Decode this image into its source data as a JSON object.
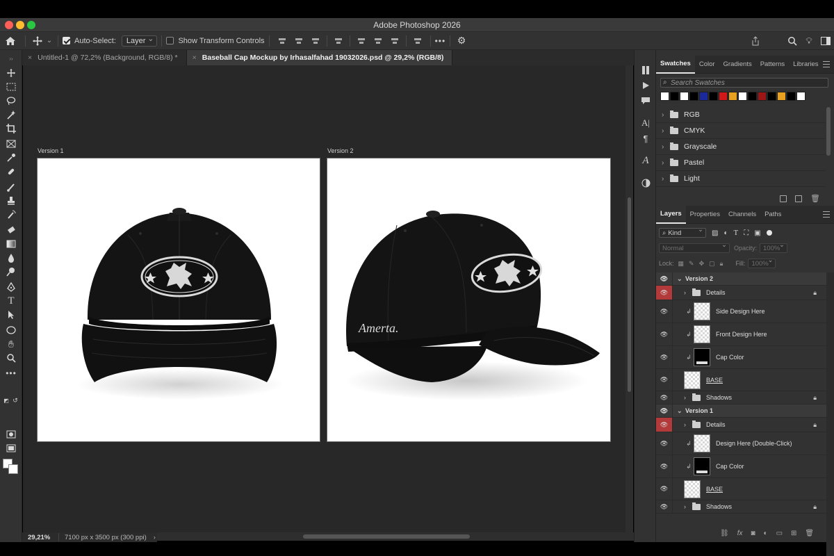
{
  "window": {
    "title": "Adobe Photoshop 2026"
  },
  "options_bar": {
    "auto_select_label": "Auto-Select:",
    "auto_select_target": "Layer",
    "show_transform_label": "Show Transform Controls",
    "more_label": "•••"
  },
  "tabs": [
    {
      "label": "Untitled-1 @ 72,2% (Background, RGB/8) *",
      "active": false
    },
    {
      "label": "Baseball Cap Mockup by Irhasalfahad 19032026.psd @ 29,2% (RGB/8)",
      "active": true
    }
  ],
  "canvas": {
    "artboards": [
      {
        "label": "Version 1",
        "view": "front"
      },
      {
        "label": "Version 2",
        "view": "side",
        "side_text": "Amerta."
      }
    ]
  },
  "status": {
    "zoom": "29,21%",
    "doc_info": "7100 px x 3500 px (300 ppi)"
  },
  "swatches_panel": {
    "tabs": [
      "Swatches",
      "Color",
      "Gradients",
      "Patterns",
      "Libraries"
    ],
    "active_tab": "Swatches",
    "search_placeholder": "Search Swatches",
    "chips": [
      "#ffffff",
      "#000000",
      "#ffffff",
      "#000000",
      "#1a2a9c",
      "#000000",
      "#d01818",
      "#e8a020",
      "#ffffff",
      "#000000",
      "#9c1616",
      "#000000",
      "#e8a020",
      "#000000",
      "#ffffff"
    ],
    "groups": [
      "RGB",
      "CMYK",
      "Grayscale",
      "Pastel",
      "Light"
    ]
  },
  "layers_panel": {
    "tabs": [
      "Layers",
      "Properties",
      "Channels",
      "Paths"
    ],
    "active_tab": "Layers",
    "filter_kind": "Kind",
    "blend_mode": "Normal",
    "opacity_label": "Opacity:",
    "opacity_value": "100%",
    "lock_label": "Lock:",
    "fill_label": "Fill:",
    "fill_value": "100%",
    "layers": [
      {
        "name": "Version 2",
        "type": "group-open",
        "eye": "normal"
      },
      {
        "name": "Details",
        "type": "group-closed",
        "eye": "red",
        "locked": true
      },
      {
        "name": "Side Design Here",
        "type": "smart",
        "eye": "normal"
      },
      {
        "name": "Front Design Here",
        "type": "smart",
        "eye": "normal"
      },
      {
        "name": "Cap Color",
        "type": "fill",
        "eye": "normal"
      },
      {
        "name": "BASE",
        "type": "base",
        "eye": "normal"
      },
      {
        "name": "Shadows",
        "type": "group-closed",
        "eye": "normal",
        "locked": true
      },
      {
        "name": "Version 1",
        "type": "group-open",
        "eye": "normal"
      },
      {
        "name": "Details",
        "type": "group-closed",
        "eye": "red",
        "locked": true
      },
      {
        "name": "Design Here (Double-Click)",
        "type": "smart",
        "eye": "normal"
      },
      {
        "name": "Cap Color",
        "type": "fill",
        "eye": "normal"
      },
      {
        "name": "BASE",
        "type": "base",
        "eye": "normal"
      },
      {
        "name": "Shadows",
        "type": "group-closed",
        "eye": "normal",
        "locked": true
      }
    ]
  }
}
